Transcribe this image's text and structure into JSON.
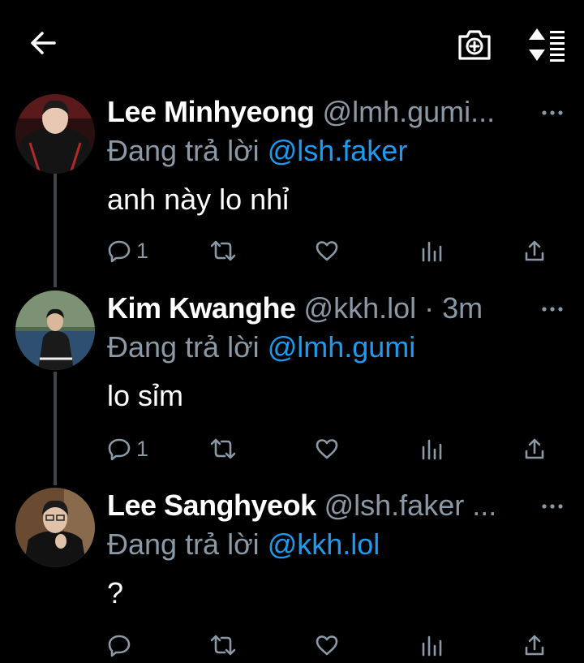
{
  "topbar": {
    "back_icon": "arrow-left-icon",
    "camera_icon": "camera-plus-icon",
    "sort_icon": "sort-lines-icon"
  },
  "tweets": [
    {
      "name": "Lee Minhyeong",
      "handle": "@lmh.gumi...",
      "reply_prefix": "Đang trả lời",
      "reply_mention": "@lsh.faker",
      "text": "anh này lo nhỉ",
      "reply_count": "1"
    },
    {
      "name": "Kim Kwanghe",
      "handle": "@kkh.lol · 3m",
      "reply_prefix": "Đang trả lời",
      "reply_mention": "@lmh.gumi",
      "text": "lo sỉm",
      "reply_count": "1"
    },
    {
      "name": "Lee Sanghyeok",
      "handle": "@lsh.faker ...",
      "reply_prefix": "Đang trả lời",
      "reply_mention": "@kkh.lol",
      "text": "?",
      "reply_count": ""
    }
  ],
  "colors": {
    "background": "#000000",
    "secondary_text": "#8b98a5",
    "mention": "#1d9bf0",
    "thread_line": "#3f4448"
  }
}
